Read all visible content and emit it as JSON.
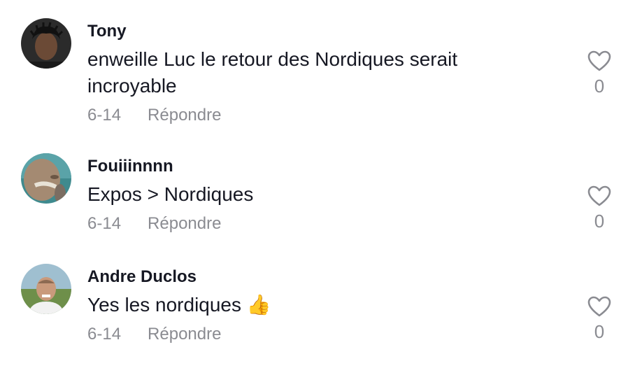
{
  "comments": [
    {
      "username": "Tony",
      "text": "enweille Luc le retour des Nordiques serait incroyable",
      "date": "6-14",
      "reply_label": "Répondre",
      "likes": "0"
    },
    {
      "username": "Fouiiinnnn",
      "text": "Expos > Nordiques",
      "date": "6-14",
      "reply_label": "Répondre",
      "likes": "0"
    },
    {
      "username": "Andre Duclos",
      "text": "Yes les nordiques",
      "emoji": "👍",
      "date": "6-14",
      "reply_label": "Répondre",
      "likes": "0"
    }
  ],
  "icons": {
    "like": "heart-outline-icon"
  },
  "colors": {
    "text": "#161823",
    "muted": "#8a8b91"
  }
}
